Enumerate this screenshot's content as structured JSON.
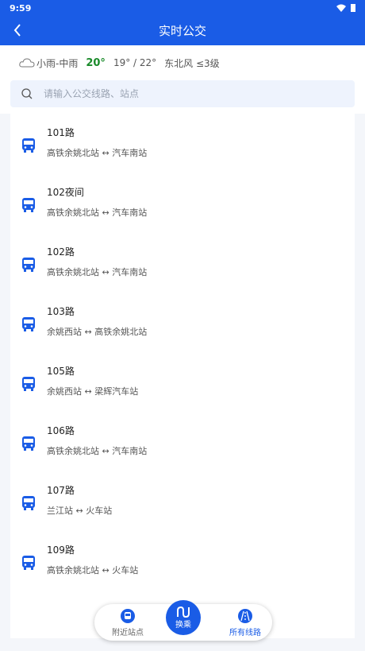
{
  "status": {
    "time": "9:59"
  },
  "header": {
    "title": "实时公交"
  },
  "weather": {
    "condition": "小雨-中雨",
    "temp": "20°",
    "range": "19° / 22°",
    "wind": "东北风 ≤3级"
  },
  "search": {
    "placeholder": "请输入公交线路、站点"
  },
  "routes": [
    {
      "name": "101路",
      "route": "高铁余姚北站 ↔ 汽车南站"
    },
    {
      "name": "102夜间",
      "route": "高铁余姚北站 ↔ 汽车南站"
    },
    {
      "name": "102路",
      "route": "高铁余姚北站 ↔ 汽车南站"
    },
    {
      "name": "103路",
      "route": "余姚西站 ↔ 高铁余姚北站"
    },
    {
      "name": "105路",
      "route": "余姚西站 ↔ 梁辉汽车站"
    },
    {
      "name": "106路",
      "route": "高铁余姚北站 ↔ 汽车南站"
    },
    {
      "name": "107路",
      "route": "兰江站 ↔ 火车站"
    },
    {
      "name": "109路",
      "route": "高铁余姚北站 ↔ 火车站"
    }
  ],
  "tabbar": {
    "nearby": "附近站点",
    "transfer": "换乘",
    "all": "所有线路"
  },
  "colors": {
    "primary": "#1a5ce6",
    "temp": "#1a8a2a"
  }
}
